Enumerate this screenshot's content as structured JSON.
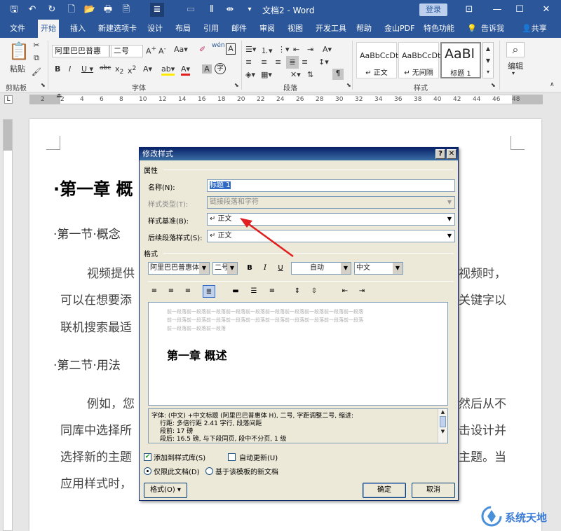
{
  "window": {
    "title": "文档2 - Word",
    "login_label": "登录",
    "controls": [
      "⊡",
      "—",
      "☐",
      "✕"
    ]
  },
  "quick_access": [
    "🖫",
    "↶",
    "↻",
    "🗋",
    "📂",
    "🖶",
    "🗎"
  ],
  "ribbon_tabs": [
    "文件",
    "开始",
    "插入",
    "新建选项卡",
    "设计",
    "布局",
    "引用",
    "邮件",
    "审阅",
    "视图",
    "开发工具",
    "帮助",
    "金山PDF",
    "特色功能",
    "告诉我",
    "共享"
  ],
  "ribbon": {
    "clipboard_group": "剪贴板",
    "paste_label": "粘贴",
    "font_group": "字体",
    "font_name": "阿里巴巴普惠",
    "font_size": "二号",
    "paragraph_group": "段落",
    "styles_group": "样式",
    "style_samples": [
      {
        "sample": "AaBbCcDt",
        "name": "↵ 正文"
      },
      {
        "sample": "AaBbCcDt",
        "name": "↵ 无间隔"
      },
      {
        "sample": "AaBl",
        "name": "标题 1"
      }
    ],
    "edit_label": "编辑"
  },
  "ruler_numbers": [
    "2",
    "2",
    "4",
    "6",
    "8",
    "10",
    "12",
    "14",
    "16",
    "18",
    "20",
    "22",
    "24",
    "26",
    "28",
    "30",
    "32",
    "34",
    "36",
    "38",
    "40",
    "42",
    "44",
    "46",
    "48"
  ],
  "document": {
    "heading1": "第一章 概",
    "section1": "第一节·概念",
    "para1_line1_left": "视频提供",
    "para1_line1_right": "视频时，",
    "para1_line2_left": "可以在想要添",
    "para1_line2_right": "关键字以",
    "para1_line3_left": "联机搜索最适",
    "section2": "第二节·用法",
    "para2_line1_left": "例如，您",
    "para2_line1_right": "然后从不",
    "para2_line2_left": "同库中选择所",
    "para2_line2_right": "击设计并",
    "para2_line3_left": "选择新的主题",
    "para2_line3_right": "主题。当",
    "para2_line4_left": "应用样式时，"
  },
  "dialog": {
    "title": "修改样式",
    "properties_label": "属性",
    "name_label": "名称(N):",
    "name_value": "标题 1",
    "type_label": "样式类型(T):",
    "type_value": "链接段落和字符",
    "based_label": "样式基准(B):",
    "based_value": "↵ 正文",
    "next_label": "后续段落样式(S):",
    "next_value": "↵ 正文",
    "format_label": "格式",
    "font_name": "阿里巴巴普惠体",
    "font_size": "二号",
    "bold": "B",
    "italic": "I",
    "underline": "U",
    "color": "自动",
    "script": "中文",
    "preview_prev_lines": [
      "前一段落前一段落前一段落前一段落前一段落前一段落前一段落前一段落前一段落前一段落",
      "前一段落前一段落前一段落前一段落前一段落前一段落前一段落前一段落前一段落前一段落",
      "前一段落前一段落前一段落"
    ],
    "preview_heading": "第一章  概述",
    "description_lines": [
      "字体: (中文) +中文标题 (阿里巴巴普惠体 H), 二号, 字距调整二号, 缩进:",
      "行距: 多倍行距 2.41 字行, 段落间距",
      "段前: 17 磅",
      "段后: 16.5 磅, 与下段同页, 段中不分页, 1 级"
    ],
    "add_to_gallery": "添加到样式库(S)",
    "auto_update": "自动更新(U)",
    "only_this_doc": "仅限此文档(D)",
    "new_docs": "基于该模板的新文档",
    "format_button": "格式(O) ▾",
    "ok_button": "确定",
    "cancel_button": "取消"
  },
  "watermark_text": "系统天地",
  "colors": {
    "word_blue": "#2b579a",
    "arrow_red": "#e02020",
    "dialog_bg": "#ece9d8"
  }
}
